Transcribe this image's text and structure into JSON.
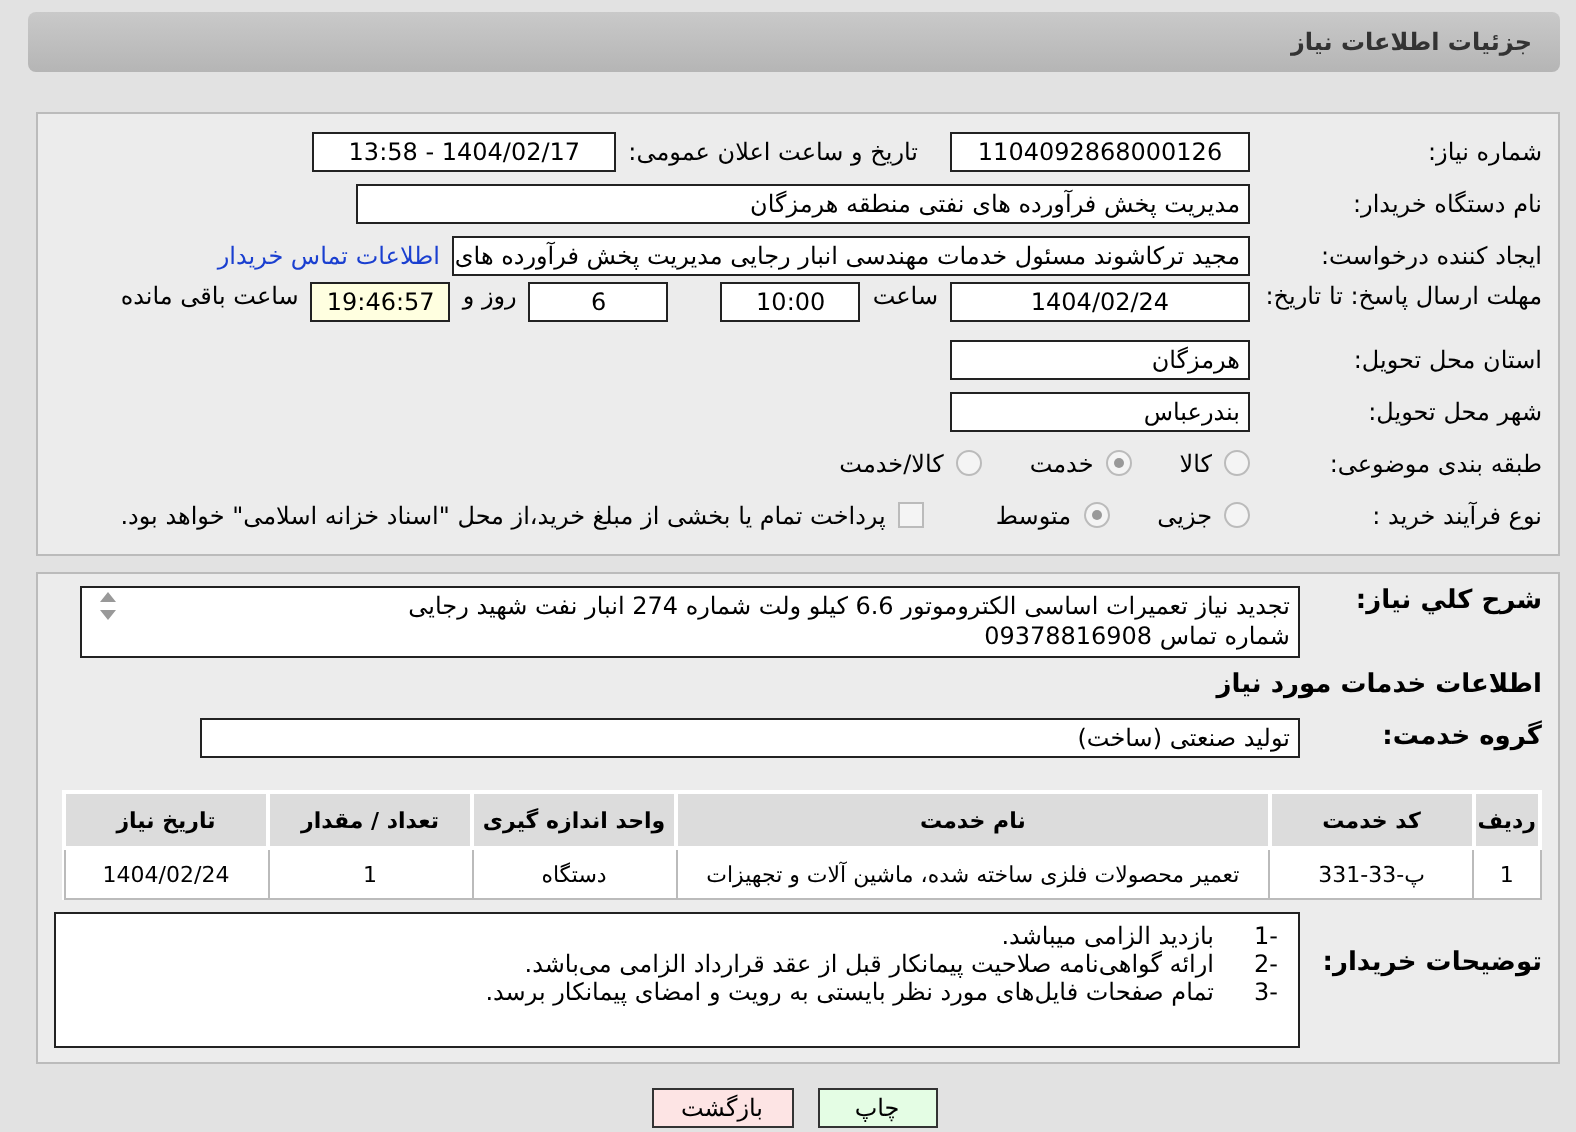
{
  "page_title": "جزئیات اطلاعات نیاز",
  "need_number": {
    "label": "شماره نیاز:",
    "value": "1104092868000126"
  },
  "announce": {
    "label": "تاریخ و ساعت اعلان عمومی:",
    "value": "1404/02/17 - 13:58"
  },
  "buyer_org": {
    "label": "نام دستگاه خریدار:",
    "value": "مدیریت پخش فرآورده های نفتی منطقه هرمزگان"
  },
  "requester": {
    "label": "ایجاد کننده درخواست:",
    "value": "مجید ترکاشوند مسئول خدمات مهندسی انبار رجایی مدیریت پخش فرآورده های",
    "contact_link": "اطلاعات تماس خریدار"
  },
  "deadline": {
    "label": "مهلت ارسال پاسخ: تا تاریخ:",
    "date": "1404/02/24",
    "time_label": "ساعت",
    "time": "10:00",
    "days": "6",
    "days_label": "روز و",
    "remaining": "19:46:57",
    "remaining_label": "ساعت باقی مانده"
  },
  "province": {
    "label": "استان محل تحویل:",
    "value": "هرمزگان"
  },
  "city": {
    "label": "شهر محل تحویل:",
    "value": "بندرعباس"
  },
  "category": {
    "label": "طبقه بندی موضوعی:",
    "options": [
      {
        "label": "کالا",
        "selected": false
      },
      {
        "label": "خدمت",
        "selected": true
      },
      {
        "label": "کالا/خدمت",
        "selected": false
      }
    ]
  },
  "process": {
    "label": "نوع فرآیند خرید :",
    "options": [
      {
        "label": "جزیی",
        "selected": false
      },
      {
        "label": "متوسط",
        "selected": true
      }
    ],
    "payment": {
      "checked": false,
      "text": "پرداخت تمام یا بخشی از مبلغ خرید،از محل \"اسناد خزانه اسلامی\" خواهد بود."
    }
  },
  "summary": {
    "label": "شرح کلي نياز:",
    "lines": [
      "تجدید نیاز تعمیرات اساسی الکتروموتور 6.6 کیلو ولت شماره 274 انبار نفت شهید رجایی",
      "شماره تماس 09378816908"
    ]
  },
  "services_heading": "اطلاعات خدمات مورد نیاز",
  "service_group": {
    "label": "گروه خدمت:",
    "value": "تولید صنعتی (ساخت)"
  },
  "table": {
    "columns": [
      "ردیف",
      "کد خدمت",
      "نام خدمت",
      "واحد اندازه گیری",
      "تعداد / مقدار",
      "تاریخ نیاز"
    ],
    "rows": [
      [
        "1",
        "پ-33-331",
        "تعمیر محصولات فلزی ساخته شده، ماشین آلات و تجهیزات",
        "دستگاه",
        "1",
        "1404/02/24"
      ]
    ]
  },
  "buyer_notes": {
    "label": "توضیحات خریدار:",
    "lines": [
      {
        "num": "1-",
        "text": "بازدید الزامی میباشد."
      },
      {
        "num": "2-",
        "text": "ارائه گواهی‌نامه صلاحیت پیمانکار قبل از عقد قرارداد الزامی می‌باشد."
      },
      {
        "num": "3-",
        "text": "تمام صفحات فایل‌های مورد نظر بایستی به رویت و امضای پیمانکار برسد."
      }
    ]
  },
  "buttons": [
    {
      "label": "چاپ",
      "kind": "print"
    },
    {
      "label": "بازگشت",
      "kind": "back"
    }
  ]
}
